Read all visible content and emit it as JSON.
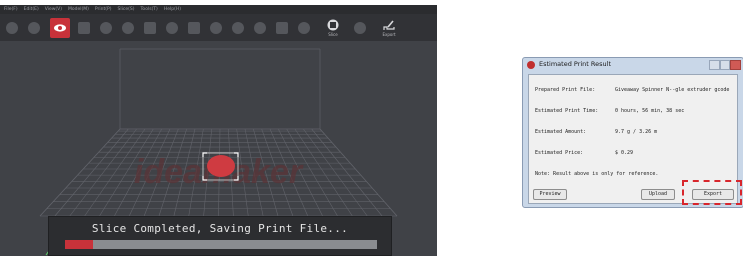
{
  "app": {
    "menu": [
      "File(F)",
      "Edit(E)",
      "View(V)",
      "Model(M)",
      "Print(P)",
      "Slice(S)",
      "Tools(T)",
      "Help(H)"
    ],
    "toolbar": {
      "icons": [
        "open-icon",
        "save-icon",
        "view-icon",
        "move-icon",
        "scale-icon",
        "rotate-icon",
        "mirror-icon",
        "support-icon",
        "cut-icon",
        "duplicate-icon",
        "undo-icon",
        "redo-icon",
        "settings-icon",
        "arrow-icon",
        "slice-icon",
        "print-icon"
      ],
      "slice_label": "Slice",
      "export_label": "Export"
    },
    "watermark": "ideamaker",
    "status": {
      "text": "Slice Completed, Saving Print File...",
      "progress": 0.09
    }
  },
  "dialog": {
    "title": "Estimated Print Result",
    "rows": [
      {
        "key": "Prepared Print File:",
        "value": "Giveaway Spinner N--gle extruder gcode"
      },
      {
        "key": "Estimated Print Time:",
        "value": "0 hours, 56 min, 38 sec"
      },
      {
        "key": "Estimated Amount:",
        "value": "9.7 g / 3.26 m"
      },
      {
        "key": "Estimated Price:",
        "value": "$ 0.29"
      }
    ],
    "note": "Note: Result above is only for reference.",
    "buttons": {
      "preview": "Preview",
      "upload": "Upload",
      "export": "Export"
    }
  },
  "colors": {
    "accent": "#c8323a",
    "highlight": "#d8262c"
  }
}
